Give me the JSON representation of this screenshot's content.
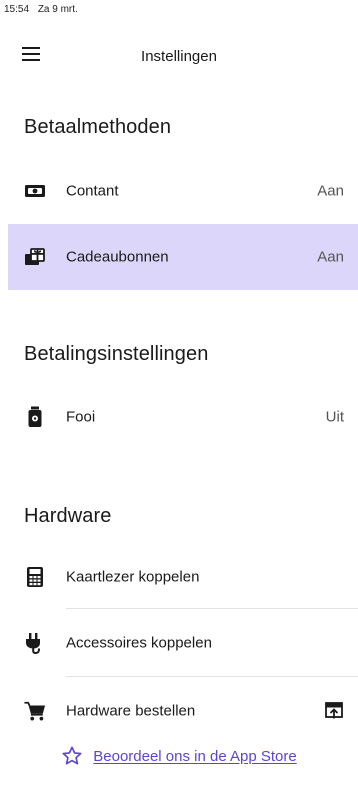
{
  "status_bar": {
    "time": "15:54",
    "date": "Za 9 mrt."
  },
  "header": {
    "title": "Instellingen",
    "menu_icon": "hamburger-menu-icon"
  },
  "sections": {
    "payment_methods": {
      "title": "Betaalmethoden",
      "items": [
        {
          "label": "Contant",
          "value": "Aan",
          "icon": "cash-icon",
          "selected": false
        },
        {
          "label": "Cadeaubonnen",
          "value": "Aan",
          "icon": "gift-card-icon",
          "selected": true
        }
      ]
    },
    "payment_settings": {
      "title": "Betalingsinstellingen",
      "items": [
        {
          "label": "Fooi",
          "value": "Uit",
          "icon": "tip-jar-icon"
        }
      ]
    },
    "hardware": {
      "title": "Hardware",
      "items": [
        {
          "label": "Kaartlezer koppelen",
          "icon": "card-reader-icon"
        },
        {
          "label": "Accessoires koppelen",
          "icon": "plug-icon"
        },
        {
          "label": "Hardware bestellen",
          "icon": "shopping-cart-icon",
          "trailing_icon": "external-link-icon"
        }
      ]
    }
  },
  "footer": {
    "rate_link": "Beoordeel ons in de App Store",
    "icon": "star-outline-icon"
  },
  "colors": {
    "selected_row": "#dcd6fb",
    "link": "#5b45d6",
    "text": "#1a1a1a"
  }
}
